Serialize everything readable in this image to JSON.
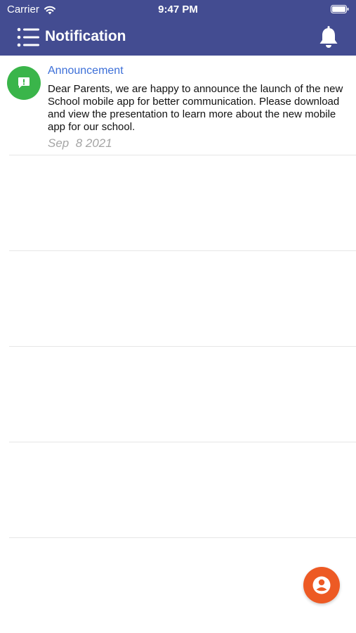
{
  "status_bar": {
    "carrier": "Carrier",
    "time": "9:47 PM"
  },
  "nav_bar": {
    "title": "Notification",
    "menu_icon": "list-menu-icon",
    "right_icon": "bell-icon"
  },
  "notifications": [
    {
      "title": "Announcement",
      "body": "Dear Parents, we are happy to announce the launch of the new School mobile app for better communication. Please download and view the presentation to learn more about the new mobile app for our school.",
      "date": "Sep  8 2021",
      "icon": "announcement-icon"
    }
  ],
  "fab": {
    "icon": "user-circle-icon"
  },
  "colors": {
    "header": "#434c91",
    "announcement_title": "#3c6fd8",
    "announcement_icon_bg": "#3ab54a",
    "fab_bg": "#ed5a24"
  }
}
